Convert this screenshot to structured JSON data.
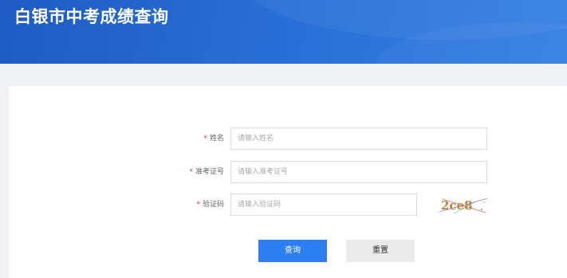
{
  "header": {
    "title": "白银市中考成绩查询"
  },
  "form": {
    "required_mark": "*",
    "name": {
      "label": "姓名",
      "placeholder": "请输入姓名",
      "value": ""
    },
    "ticket": {
      "label": "准考证号",
      "placeholder": "请输入准考证号",
      "value": ""
    },
    "captcha": {
      "label": "验证码",
      "placeholder": "请输入验证码",
      "value": "",
      "image_text": "2ce8"
    }
  },
  "buttons": {
    "query_label": "查询",
    "reset_label": "重置"
  },
  "colors": {
    "header_bg": "#2569d2",
    "primary_button": "#2d7ef0",
    "required_star": "#e8342f"
  }
}
